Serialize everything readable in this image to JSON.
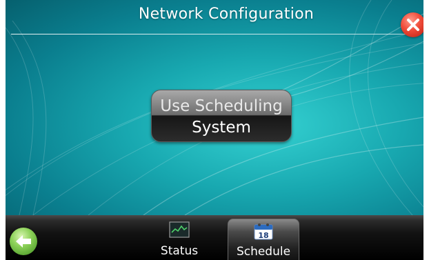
{
  "header": {
    "title": "Network Configuration"
  },
  "main": {
    "scheduling_button": {
      "line1": "Use Scheduling",
      "line2": "System"
    }
  },
  "bottom_bar": {
    "tabs": [
      {
        "label": "Status",
        "icon": "status-chart-icon",
        "selected": false
      },
      {
        "label": "Schedule",
        "icon": "calendar-icon",
        "selected": true
      }
    ],
    "calendar_day": "18"
  },
  "icons": {
    "close": "close-icon",
    "back": "back-arrow-icon"
  },
  "colors": {
    "background_teal": "#18a8b0",
    "close_red": "#ef4a38",
    "back_green": "#8cd158",
    "bar_black": "#000000"
  }
}
